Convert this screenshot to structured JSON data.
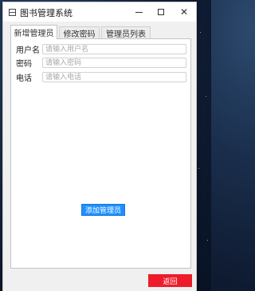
{
  "window": {
    "title": "图书管理系统"
  },
  "tabs": [
    {
      "label": "新增管理员",
      "active": true
    },
    {
      "label": "修改密码",
      "active": false
    },
    {
      "label": "管理员列表",
      "active": false
    }
  ],
  "form": {
    "fields": [
      {
        "label": "用户名",
        "placeholder": "请输入用户名",
        "value": ""
      },
      {
        "label": "密码",
        "placeholder": "请输入密码",
        "value": ""
      },
      {
        "label": "电话",
        "placeholder": "请输入电话",
        "value": ""
      }
    ],
    "submit_label": "添加管理员"
  },
  "footer": {
    "back_label": "返回"
  },
  "colors": {
    "primary_button": "#1e90ff",
    "back_button": "#ee1c2a"
  },
  "icons": {
    "app": "app-icon",
    "minimize": "minimize-icon",
    "maximize": "maximize-icon",
    "close": "close-icon"
  }
}
